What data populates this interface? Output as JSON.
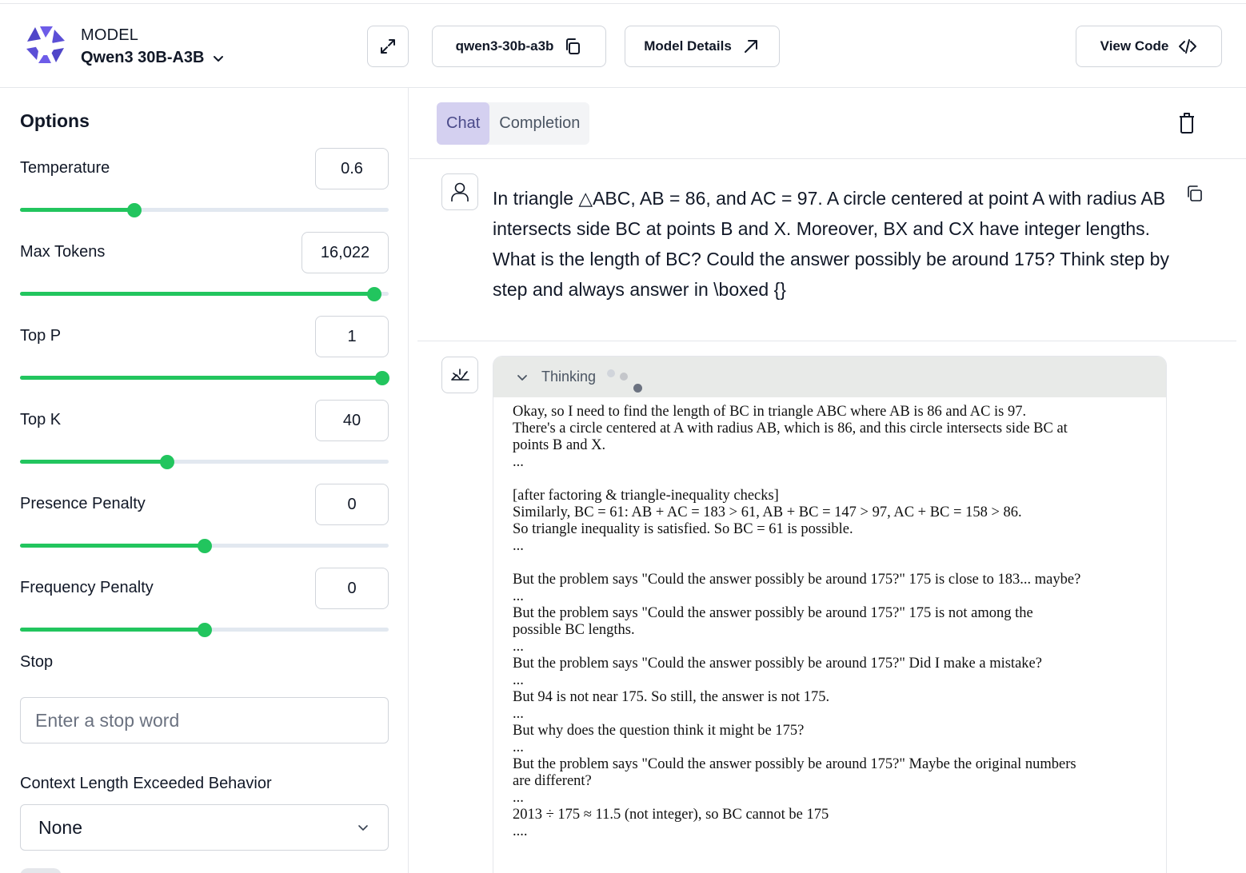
{
  "header": {
    "model_label": "MODEL",
    "model_name": "Qwen3 30B-A3B",
    "model_slug": "qwen3-30b-a3b",
    "details_label": "Model Details",
    "view_code_label": "View Code"
  },
  "options": {
    "title": "Options",
    "temperature": {
      "label": "Temperature",
      "value": "0.6",
      "fraction": 0.31
    },
    "max_tokens": {
      "label": "Max Tokens",
      "value": "16,022",
      "fraction": 0.961
    },
    "top_p": {
      "label": "Top P",
      "value": "1",
      "fraction": 0.983
    },
    "top_k": {
      "label": "Top K",
      "value": "40",
      "fraction": 0.399
    },
    "presence_penalty": {
      "label": "Presence Penalty",
      "value": "0",
      "fraction": 0.5
    },
    "frequency_penalty": {
      "label": "Frequency Penalty",
      "value": "0",
      "fraction": 0.5
    },
    "stop": {
      "label": "Stop",
      "placeholder": "Enter a stop word"
    },
    "context_behavior": {
      "label": "Context Length Exceeded Behavior",
      "value": "None"
    }
  },
  "tabs": [
    {
      "label": "Chat",
      "active": true
    },
    {
      "label": "Completion",
      "active": false
    }
  ],
  "user_message": "In triangle △ABC, AB = 86, and AC = 97. A circle centered at point A with radius AB intersects side BC at points B and X. Moreover, BX and CX have integer lengths. What is the length of BC? Could the answer possibly be around 175? Think step by step and always answer in \\boxed {}",
  "thinking": {
    "label": "Thinking",
    "lines": [
      "Okay, so I need to find the length of BC in triangle ABC where AB is 86 and AC is 97.",
      "There's a circle centered at A with radius AB, which is 86, and this circle intersects side BC at",
      "points B and X.",
      "...",
      "",
      "[after factoring & triangle-inequality checks]",
      "Similarly, BC = 61: AB + AC = 183 > 61, AB + BC = 147 > 97, AC + BC = 158 > 86.",
      "So triangle inequality is satisfied. So BC = 61 is possible.",
      "...",
      "",
      "But the problem says \"Could the answer possibly be around 175?\" 175 is close to 183... maybe?",
      "...",
      "But the problem says \"Could the answer possibly be around 175?\" 175 is not among the",
      "possible BC lengths.",
      "...",
      "But the problem says \"Could the answer possibly be around 175?\" Did I make a mistake?",
      "...",
      "But 94 is not near 175. So still, the answer is not 175.",
      "...",
      "But why does the question think it might be 175?",
      "...",
      "But the problem says \"Could the answer possibly be around 175?\" Maybe the original numbers",
      "are different?",
      "...",
      "2013 ÷ 175 ≈ 11.5 (not integer), so BC cannot be 175",
      "...."
    ]
  },
  "colors": {
    "accent_green": "#22c55e",
    "tab_active_bg": "#d4d0f0",
    "logo_purple": "#5b4fd6"
  },
  "icons": {
    "logo": "qwen-logo-icon",
    "expand": "expand-icon",
    "copy": "copy-icon",
    "external": "arrow-up-right-icon",
    "code": "code-icon",
    "trash": "trash-icon",
    "user": "user-icon",
    "bot": "bot-icon",
    "chevron": "chevron-down-icon"
  }
}
